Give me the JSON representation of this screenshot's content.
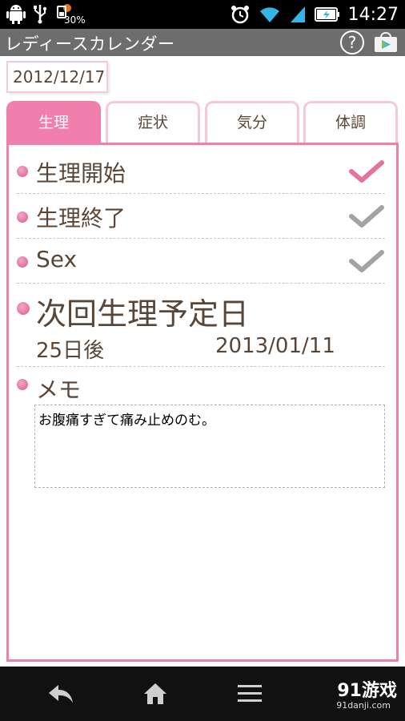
{
  "status_bar": {
    "battery_percent": "30%",
    "time": "14:27"
  },
  "app": {
    "title": "レディースカレンダー",
    "help_label": "?"
  },
  "date": "2012/12/17",
  "tabs": [
    {
      "label": "生理",
      "active": true
    },
    {
      "label": "症状",
      "active": false
    },
    {
      "label": "気分",
      "active": false
    },
    {
      "label": "体調",
      "active": false
    }
  ],
  "items": [
    {
      "label": "生理開始",
      "checked": true
    },
    {
      "label": "生理終了",
      "checked": false
    },
    {
      "label": "Sex",
      "checked": false
    }
  ],
  "next_period": {
    "label": "次回生理予定日",
    "days_until": "25日後",
    "date": "2013/01/11"
  },
  "memo": {
    "label": "メモ",
    "text": "お腹痛すぎて痛み止めのむ。"
  },
  "watermark": {
    "brand": "91游戏",
    "url": "91danji.com"
  },
  "colors": {
    "accent_pink": "#f07fac",
    "check_active": "#e2749f",
    "check_inactive": "#a3a3a3",
    "text_brown": "#5a4636"
  }
}
